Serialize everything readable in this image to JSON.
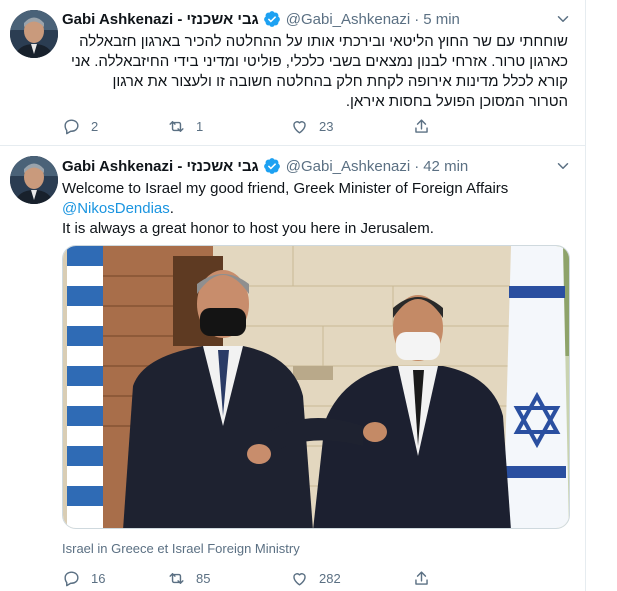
{
  "tweets": [
    {
      "author_name": "Gabi Ashkenazi - גבי אשכנזי",
      "handle": "@Gabi_Ashkenazi",
      "separator": "·",
      "time": "5 min",
      "text_lines": [
        "שוחחתי עם שר החוץ הליטאי ובירכתי אותו על ההחלטה להכיר בארגון חזבאללה",
        "כארגון טרור. אזרחי לבנון נמצאים בשבי כלכלי, פוליטי ומדיני בידי החיזבאללה. אני",
        "קורא לכלל מדינות אירופה לקחת חלק בהחלטה חשובה זו ולעצור את ארגון",
        "הטרור המסוכן הפועל בחסות איראן."
      ],
      "actions": {
        "reply_count": "2",
        "retweet_count": "1",
        "like_count": "23"
      }
    },
    {
      "author_name": "Gabi Ashkenazi - גבי אשכנזי",
      "handle": "@Gabi_Ashkenazi",
      "separator": "·",
      "time": "42 min",
      "text_line1": "Welcome to Israel my good friend, Greek Minister of Foreign Affairs",
      "mention": "@NikosDendias",
      "mention_suffix": ".",
      "text_line3": "It is always a great honor to host you here in Jerusalem.",
      "media_caption": "Israel in Greece et Israel Foreign Ministry",
      "actions": {
        "reply_count": "16",
        "retweet_count": "85",
        "like_count": "282"
      }
    }
  ],
  "colors": {
    "accent": "#1b95e0",
    "verified": "#1da1f2",
    "secondary_text": "#5b7083",
    "divider": "#e6ecf0"
  },
  "icons": [
    "verified-badge-icon",
    "chevron-down-icon",
    "reply-icon",
    "retweet-icon",
    "like-icon",
    "share-icon"
  ]
}
